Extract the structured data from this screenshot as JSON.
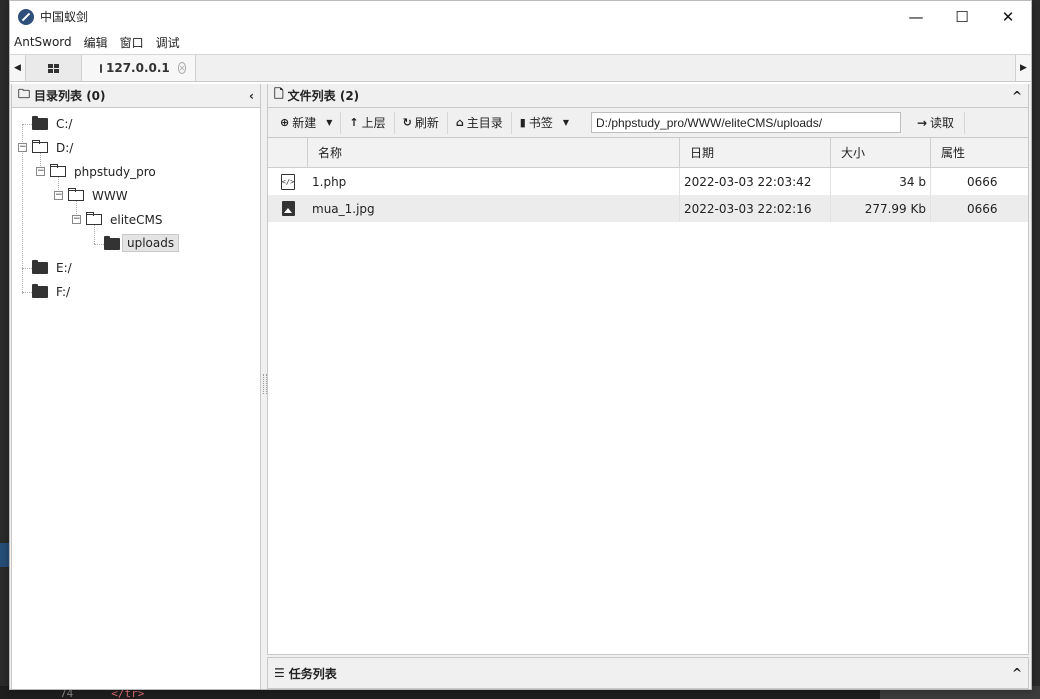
{
  "window": {
    "title": "中国蚁剑",
    "controls": {
      "minimize": "—",
      "maximize": "☐",
      "close": "✕"
    }
  },
  "menu": [
    "AntSword",
    "编辑",
    "窗口",
    "调试"
  ],
  "tabs": {
    "left_arrow": "◀",
    "right_arrow": "▶",
    "active_label": "127.0.0.1",
    "close_glyph": "✕"
  },
  "dir_panel": {
    "title": "目录列表 (0)",
    "collapse": "‹",
    "tree": [
      {
        "label": "C:/",
        "state": "closed"
      },
      {
        "label": "D:/",
        "state": "open"
      },
      {
        "label": "phpstudy_pro",
        "state": "open"
      },
      {
        "label": "WWW",
        "state": "open"
      },
      {
        "label": "eliteCMS",
        "state": "open"
      },
      {
        "label": "uploads",
        "state": "selected"
      },
      {
        "label": "E:/",
        "state": "closed"
      },
      {
        "label": "F:/",
        "state": "closed"
      }
    ]
  },
  "file_panel": {
    "title": "文件列表 (2)",
    "collapse": "^",
    "toolbar": {
      "new": "新建",
      "up": "上层",
      "refresh": "刷新",
      "home": "主目录",
      "bookmarks": "书签",
      "path": "D:/phpstudy_pro/WWW/eliteCMS/uploads/",
      "read": "读取"
    },
    "columns": [
      "名称",
      "日期",
      "大小",
      "属性"
    ],
    "files": [
      {
        "icon": "php-file-icon",
        "name": "1.php",
        "date": "2022-03-03 22:03:42",
        "size": "34 b",
        "attr": "0666"
      },
      {
        "icon": "image-file-icon",
        "name": "mua_1.jpg",
        "date": "2022-03-03 22:02:16",
        "size": "277.99 Kb",
        "attr": "0666"
      }
    ]
  },
  "task_panel": {
    "title": "任务列表",
    "collapse": "^"
  },
  "background": {
    "line_no": "74",
    "code": "</tr>"
  }
}
